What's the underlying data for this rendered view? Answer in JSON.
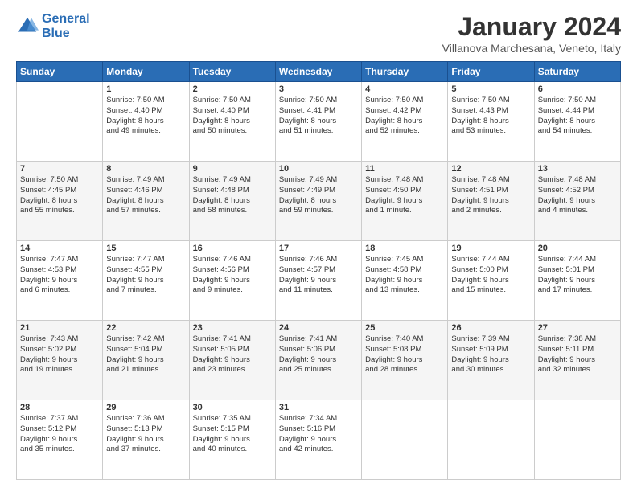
{
  "header": {
    "logo_line1": "General",
    "logo_line2": "Blue",
    "title": "January 2024",
    "subtitle": "Villanova Marchesana, Veneto, Italy"
  },
  "weekdays": [
    "Sunday",
    "Monday",
    "Tuesday",
    "Wednesday",
    "Thursday",
    "Friday",
    "Saturday"
  ],
  "weeks": [
    [
      {
        "day": "",
        "info": ""
      },
      {
        "day": "1",
        "info": "Sunrise: 7:50 AM\nSunset: 4:40 PM\nDaylight: 8 hours\nand 49 minutes."
      },
      {
        "day": "2",
        "info": "Sunrise: 7:50 AM\nSunset: 4:40 PM\nDaylight: 8 hours\nand 50 minutes."
      },
      {
        "day": "3",
        "info": "Sunrise: 7:50 AM\nSunset: 4:41 PM\nDaylight: 8 hours\nand 51 minutes."
      },
      {
        "day": "4",
        "info": "Sunrise: 7:50 AM\nSunset: 4:42 PM\nDaylight: 8 hours\nand 52 minutes."
      },
      {
        "day": "5",
        "info": "Sunrise: 7:50 AM\nSunset: 4:43 PM\nDaylight: 8 hours\nand 53 minutes."
      },
      {
        "day": "6",
        "info": "Sunrise: 7:50 AM\nSunset: 4:44 PM\nDaylight: 8 hours\nand 54 minutes."
      }
    ],
    [
      {
        "day": "7",
        "info": "Sunrise: 7:50 AM\nSunset: 4:45 PM\nDaylight: 8 hours\nand 55 minutes."
      },
      {
        "day": "8",
        "info": "Sunrise: 7:49 AM\nSunset: 4:46 PM\nDaylight: 8 hours\nand 57 minutes."
      },
      {
        "day": "9",
        "info": "Sunrise: 7:49 AM\nSunset: 4:48 PM\nDaylight: 8 hours\nand 58 minutes."
      },
      {
        "day": "10",
        "info": "Sunrise: 7:49 AM\nSunset: 4:49 PM\nDaylight: 8 hours\nand 59 minutes."
      },
      {
        "day": "11",
        "info": "Sunrise: 7:48 AM\nSunset: 4:50 PM\nDaylight: 9 hours\nand 1 minute."
      },
      {
        "day": "12",
        "info": "Sunrise: 7:48 AM\nSunset: 4:51 PM\nDaylight: 9 hours\nand 2 minutes."
      },
      {
        "day": "13",
        "info": "Sunrise: 7:48 AM\nSunset: 4:52 PM\nDaylight: 9 hours\nand 4 minutes."
      }
    ],
    [
      {
        "day": "14",
        "info": "Sunrise: 7:47 AM\nSunset: 4:53 PM\nDaylight: 9 hours\nand 6 minutes."
      },
      {
        "day": "15",
        "info": "Sunrise: 7:47 AM\nSunset: 4:55 PM\nDaylight: 9 hours\nand 7 minutes."
      },
      {
        "day": "16",
        "info": "Sunrise: 7:46 AM\nSunset: 4:56 PM\nDaylight: 9 hours\nand 9 minutes."
      },
      {
        "day": "17",
        "info": "Sunrise: 7:46 AM\nSunset: 4:57 PM\nDaylight: 9 hours\nand 11 minutes."
      },
      {
        "day": "18",
        "info": "Sunrise: 7:45 AM\nSunset: 4:58 PM\nDaylight: 9 hours\nand 13 minutes."
      },
      {
        "day": "19",
        "info": "Sunrise: 7:44 AM\nSunset: 5:00 PM\nDaylight: 9 hours\nand 15 minutes."
      },
      {
        "day": "20",
        "info": "Sunrise: 7:44 AM\nSunset: 5:01 PM\nDaylight: 9 hours\nand 17 minutes."
      }
    ],
    [
      {
        "day": "21",
        "info": "Sunrise: 7:43 AM\nSunset: 5:02 PM\nDaylight: 9 hours\nand 19 minutes."
      },
      {
        "day": "22",
        "info": "Sunrise: 7:42 AM\nSunset: 5:04 PM\nDaylight: 9 hours\nand 21 minutes."
      },
      {
        "day": "23",
        "info": "Sunrise: 7:41 AM\nSunset: 5:05 PM\nDaylight: 9 hours\nand 23 minutes."
      },
      {
        "day": "24",
        "info": "Sunrise: 7:41 AM\nSunset: 5:06 PM\nDaylight: 9 hours\nand 25 minutes."
      },
      {
        "day": "25",
        "info": "Sunrise: 7:40 AM\nSunset: 5:08 PM\nDaylight: 9 hours\nand 28 minutes."
      },
      {
        "day": "26",
        "info": "Sunrise: 7:39 AM\nSunset: 5:09 PM\nDaylight: 9 hours\nand 30 minutes."
      },
      {
        "day": "27",
        "info": "Sunrise: 7:38 AM\nSunset: 5:11 PM\nDaylight: 9 hours\nand 32 minutes."
      }
    ],
    [
      {
        "day": "28",
        "info": "Sunrise: 7:37 AM\nSunset: 5:12 PM\nDaylight: 9 hours\nand 35 minutes."
      },
      {
        "day": "29",
        "info": "Sunrise: 7:36 AM\nSunset: 5:13 PM\nDaylight: 9 hours\nand 37 minutes."
      },
      {
        "day": "30",
        "info": "Sunrise: 7:35 AM\nSunset: 5:15 PM\nDaylight: 9 hours\nand 40 minutes."
      },
      {
        "day": "31",
        "info": "Sunrise: 7:34 AM\nSunset: 5:16 PM\nDaylight: 9 hours\nand 42 minutes."
      },
      {
        "day": "",
        "info": ""
      },
      {
        "day": "",
        "info": ""
      },
      {
        "day": "",
        "info": ""
      }
    ]
  ]
}
